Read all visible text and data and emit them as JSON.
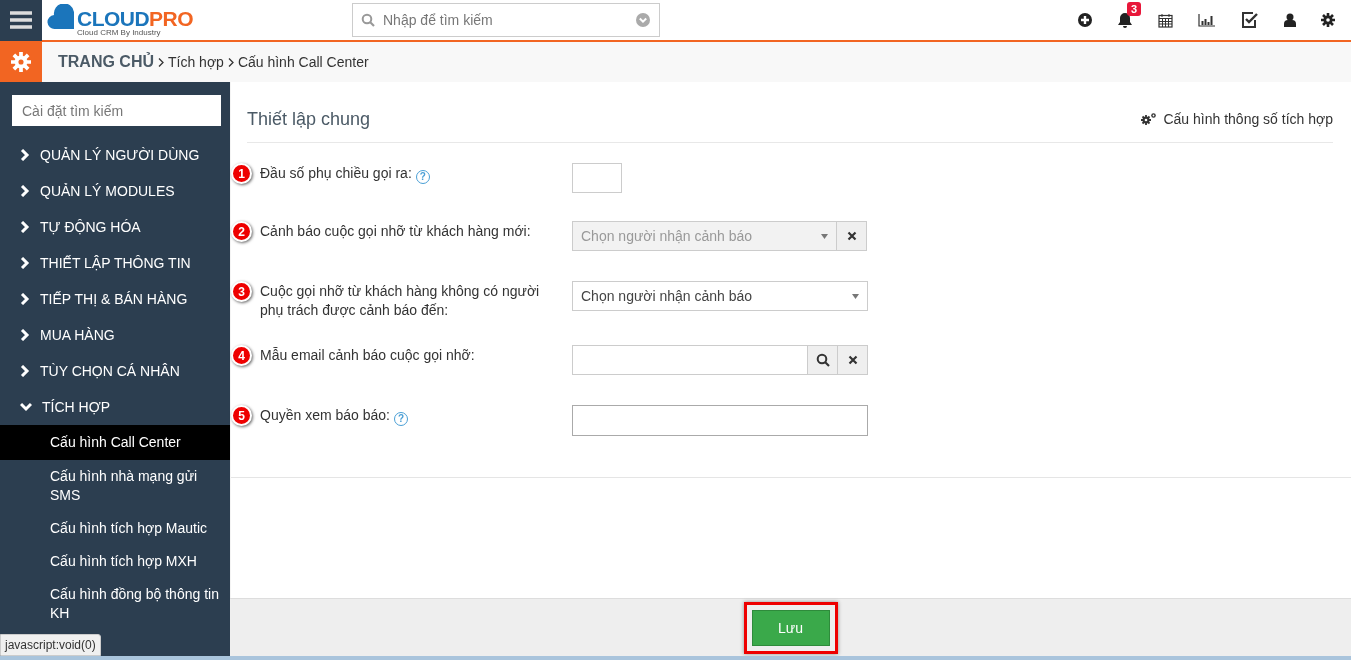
{
  "header": {
    "logo": {
      "brand_a": "CLOUD",
      "brand_b": "PRO",
      "tagline": "Cloud CRM By Industry"
    },
    "search": {
      "placeholder": "Nhập để tìm kiếm"
    },
    "notification_count": "3"
  },
  "breadcrumb": [
    "TRANG CHỦ",
    "Tích hợp",
    "Cấu hình Call Center"
  ],
  "sidebar": {
    "search": {
      "placeholder": "Cài đặt tìm kiếm"
    },
    "items": [
      {
        "label": "QUẢN LÝ NGƯỜI DÙNG",
        "expanded": false
      },
      {
        "label": "QUẢN LÝ MODULES",
        "expanded": false
      },
      {
        "label": "TỰ ĐỘNG HÓA",
        "expanded": false
      },
      {
        "label": "THIẾT LẬP THÔNG TIN",
        "expanded": false
      },
      {
        "label": "TIẾP THỊ & BÁN HÀNG",
        "expanded": false
      },
      {
        "label": "MUA HÀNG",
        "expanded": false
      },
      {
        "label": "TÙY CHỌN CÁ NHÂN",
        "expanded": false
      },
      {
        "label": "TÍCH HỢP",
        "expanded": true,
        "children": [
          {
            "label": "Cấu hình Call Center",
            "selected": true
          },
          {
            "label": "Cấu hình nhà mạng gửi SMS",
            "selected": false
          },
          {
            "label": "Cấu hình tích hợp Mautic",
            "selected": false
          },
          {
            "label": "Cấu hình tích hợp MXH",
            "selected": false
          },
          {
            "label": "Cấu hình đồng bộ thông tin KH",
            "selected": false
          }
        ]
      }
    ]
  },
  "panel": {
    "title": "Thiết lập chung",
    "config_link": "Cấu hình thông số tích hợp",
    "fields": [
      {
        "number": "1",
        "label": "Đầu số phụ chiều gọi ra:",
        "help": "?",
        "kind": "short"
      },
      {
        "number": "2",
        "label": "Cảnh báo cuộc gọi nhỡ từ khách hàng mới:",
        "kind": "select-clear",
        "placeholder": "Chọn người nhận cảnh báo",
        "disabled": true
      },
      {
        "number": "3",
        "label": "Cuộc gọi nhỡ từ khách hàng không có người phụ trách được cảnh báo đến:",
        "kind": "select",
        "placeholder": "Chọn người nhận cảnh báo",
        "disabled": false
      },
      {
        "number": "4",
        "label": "Mẫu email cảnh báo cuộc gọi nhỡ:",
        "kind": "lookup"
      },
      {
        "number": "5",
        "label": "Quyền xem báo báo:",
        "help": "?",
        "kind": "wide"
      }
    ]
  },
  "footer": {
    "save_button": "Lưu"
  },
  "status_bar": "javascript:void(0)"
}
